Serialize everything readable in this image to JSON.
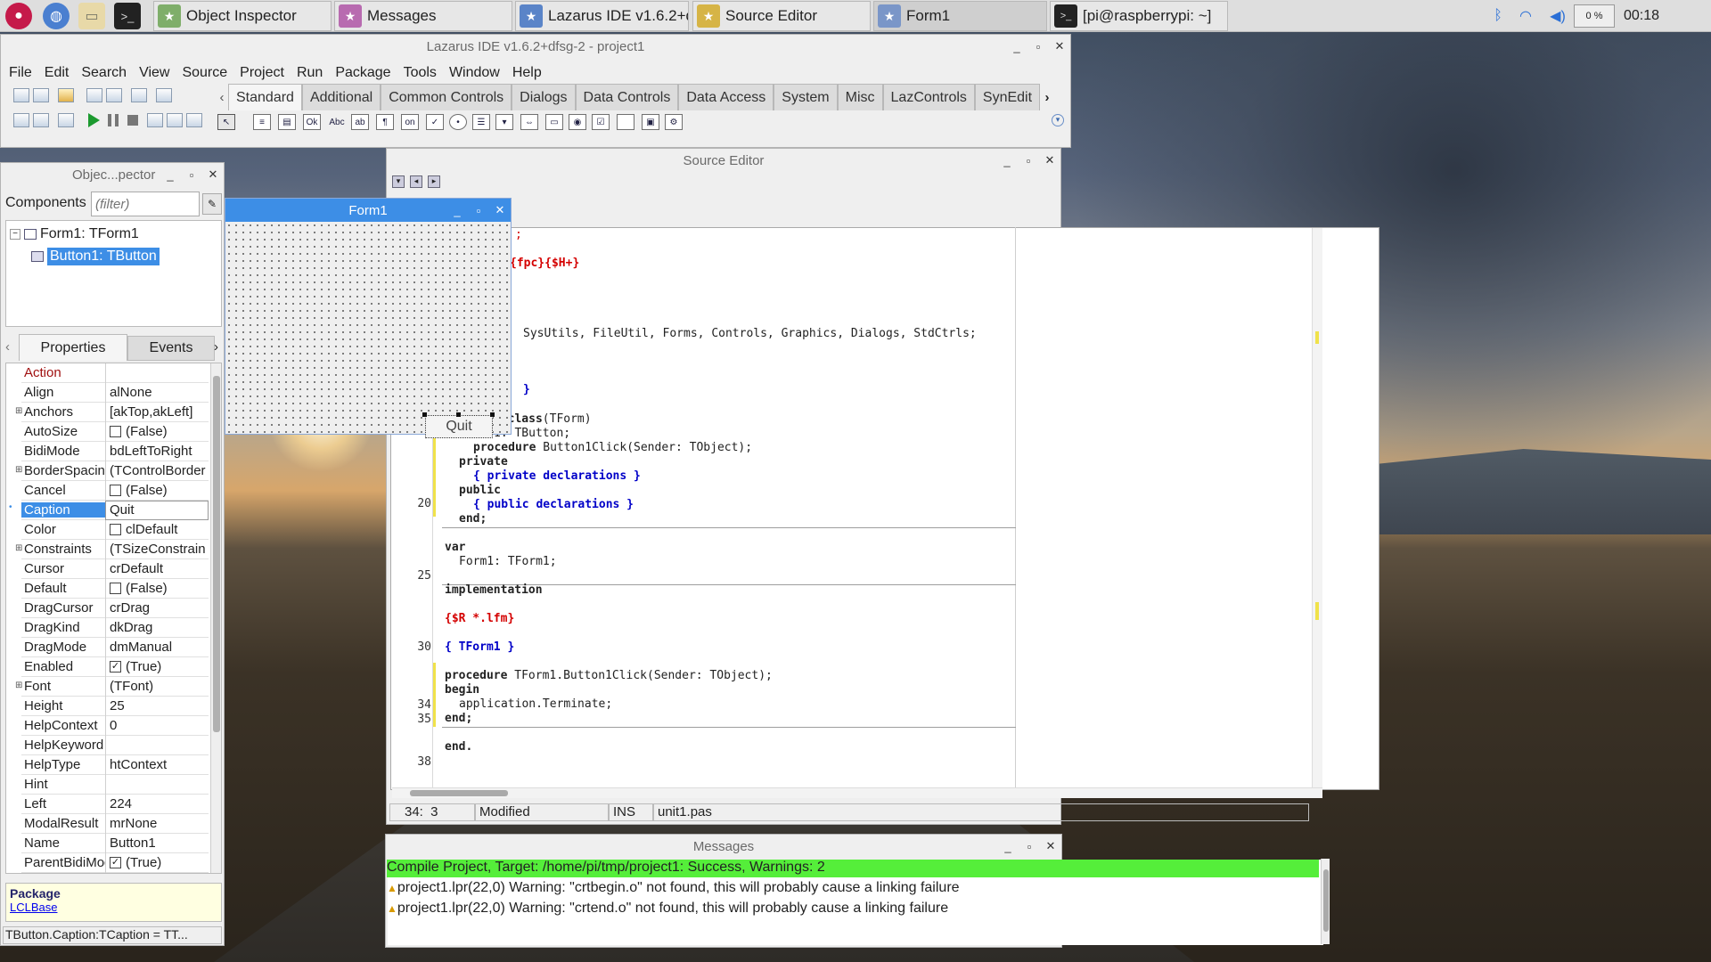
{
  "taskbar": {
    "tasks": [
      {
        "label": "Object Inspector",
        "icon": "object-inspector-icon"
      },
      {
        "label": "Messages",
        "icon": "messages-icon"
      },
      {
        "label": "Lazarus IDE v1.6.2+d...",
        "icon": "lazarus-icon"
      },
      {
        "label": "Source Editor",
        "icon": "source-editor-icon"
      },
      {
        "label": "Form1",
        "icon": "form-icon"
      },
      {
        "label": "[pi@raspberrypi: ~]",
        "icon": "terminal-icon"
      }
    ],
    "cpu": "0 %",
    "clock": "00:18"
  },
  "ide": {
    "title": "Lazarus IDE v1.6.2+dfsg-2 - project1",
    "menu": [
      "File",
      "Edit",
      "Search",
      "View",
      "Source",
      "Project",
      "Run",
      "Package",
      "Tools",
      "Window",
      "Help"
    ],
    "palette_tabs": [
      "Standard",
      "Additional",
      "Common Controls",
      "Dialogs",
      "Data Controls",
      "Data Access",
      "System",
      "Misc",
      "LazControls",
      "SynEdit"
    ],
    "selected_palette_tab": "Standard"
  },
  "inspector": {
    "title": "Objec...pector",
    "components_label": "Components",
    "filter_placeholder": "(filter)",
    "tree": [
      "Form1: TForm1",
      "Button1: TButton"
    ],
    "tabs": [
      "Properties",
      "Events"
    ],
    "properties": [
      {
        "name": "Action",
        "value": ""
      },
      {
        "name": "Align",
        "value": "alNone"
      },
      {
        "name": "Anchors",
        "value": "[akTop,akLeft]"
      },
      {
        "name": "AutoSize",
        "value": "(False)"
      },
      {
        "name": "BidiMode",
        "value": "bdLeftToRight"
      },
      {
        "name": "BorderSpacing",
        "value": "(TControlBorder"
      },
      {
        "name": "Cancel",
        "value": "(False)"
      },
      {
        "name": "Caption",
        "value": "Quit"
      },
      {
        "name": "Color",
        "value": "clDefault"
      },
      {
        "name": "Constraints",
        "value": "(TSizeConstrain"
      },
      {
        "name": "Cursor",
        "value": "crDefault"
      },
      {
        "name": "Default",
        "value": "(False)"
      },
      {
        "name": "DragCursor",
        "value": "crDrag"
      },
      {
        "name": "DragKind",
        "value": "dkDrag"
      },
      {
        "name": "DragMode",
        "value": "dmManual"
      },
      {
        "name": "Enabled",
        "value": "(True)"
      },
      {
        "name": "Font",
        "value": "(TFont)"
      },
      {
        "name": "Height",
        "value": "25"
      },
      {
        "name": "HelpContext",
        "value": "0"
      },
      {
        "name": "HelpKeyword",
        "value": ""
      },
      {
        "name": "HelpType",
        "value": "htContext"
      },
      {
        "name": "Hint",
        "value": ""
      },
      {
        "name": "Left",
        "value": "224"
      },
      {
        "name": "ModalResult",
        "value": "mrNone"
      },
      {
        "name": "Name",
        "value": "Button1"
      },
      {
        "name": "ParentBidiMode",
        "value": "(True)"
      }
    ],
    "package_label": "Package",
    "package_link": "LCLBase",
    "status": "TButton.Caption:TCaption = TT..."
  },
  "form": {
    "title": "Form1",
    "button_caption": "Quit"
  },
  "editor": {
    "title": "Source Editor",
    "gutter": [
      "20",
      "25",
      "30",
      "34",
      "35",
      "38"
    ],
    "code": {
      "l1": ";",
      "l2": "{fpc}{$H+}",
      "l3": "SysUtils, FileUtil, Forms, Controls, Graphics, Dialogs, StdCtrls;",
      "l4": "}",
      "l5_op": "= ",
      "l5_kw": "class",
      "l5_rest": "(TForm)",
      "l6": "1: TButton;",
      "l7_kw": "procedure",
      "l7_rest": " Button1Click(Sender: TObject);",
      "l8": "private",
      "l9": "{ private declarations }",
      "l10": "public",
      "l11": "{ public declarations }",
      "l12": "end;",
      "l13": "var",
      "l14": "Form1: TForm1;",
      "l15": "implementation",
      "l16": "{$R *.lfm}",
      "l17": "{ TForm1 }",
      "l18_kw": "procedure",
      "l18_rest": " TForm1.Button1Click(Sender: TObject);",
      "l19": "begin",
      "l20": "application.Terminate;",
      "l21": "end;",
      "l22": "end."
    },
    "status": {
      "pos": "34:  3",
      "modified": "Modified",
      "mode": "INS",
      "file": "unit1.pas"
    }
  },
  "messages": {
    "title": "Messages",
    "success": "Compile Project, Target: /home/pi/tmp/project1: Success, Warnings: 2",
    "warnings": [
      "project1.lpr(22,0) Warning: \"crtbegin.o\" not found, this will probably cause a linking failure",
      "project1.lpr(22,0) Warning: \"crtend.o\" not found, this will probably cause a linking failure"
    ]
  },
  "colors": {
    "selection": "#3d8ee6",
    "success": "#55ee3a",
    "directive": "#d40000",
    "comment": "#0000c8",
    "help_box": "#ffffe1"
  }
}
